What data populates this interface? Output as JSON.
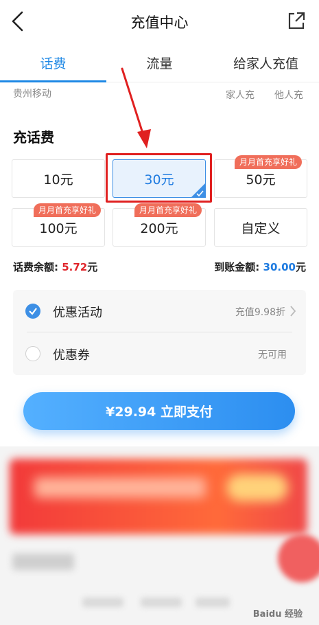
{
  "header": {
    "title": "充值中心"
  },
  "tabs": [
    {
      "label": "话费"
    },
    {
      "label": "流量"
    },
    {
      "label": "给家人充值"
    }
  ],
  "account": {
    "carrier": "贵州移动",
    "family_link": "家人充",
    "other_link": "他人充"
  },
  "section_title": "充话费",
  "amounts": [
    {
      "label": "10元",
      "tag": ""
    },
    {
      "label": "30元",
      "tag": "",
      "selected": true
    },
    {
      "label": "50元",
      "tag": "月月首充享好礼"
    },
    {
      "label": "100元",
      "tag": "月月首充享好礼"
    },
    {
      "label": "200元",
      "tag": "月月首充享好礼"
    },
    {
      "label": "自定义",
      "tag": ""
    }
  ],
  "balance": {
    "label": "话费余额:",
    "value": "5.72",
    "unit": "元",
    "arrival_label": "到账金额:",
    "arrival_value": "30.00",
    "arrival_unit": "元"
  },
  "discount": {
    "activity_label": "优惠活动",
    "activity_value": "充值9.98折",
    "coupon_label": "优惠券",
    "coupon_value": "无可用"
  },
  "pay_button": {
    "label": "¥29.94 立即支付"
  },
  "watermark": "Baidu 经验",
  "colors": {
    "accent": "#1e88e5",
    "price_red": "#e0262c",
    "tag_red": "#f06e5a",
    "highlight": "#e02020"
  }
}
